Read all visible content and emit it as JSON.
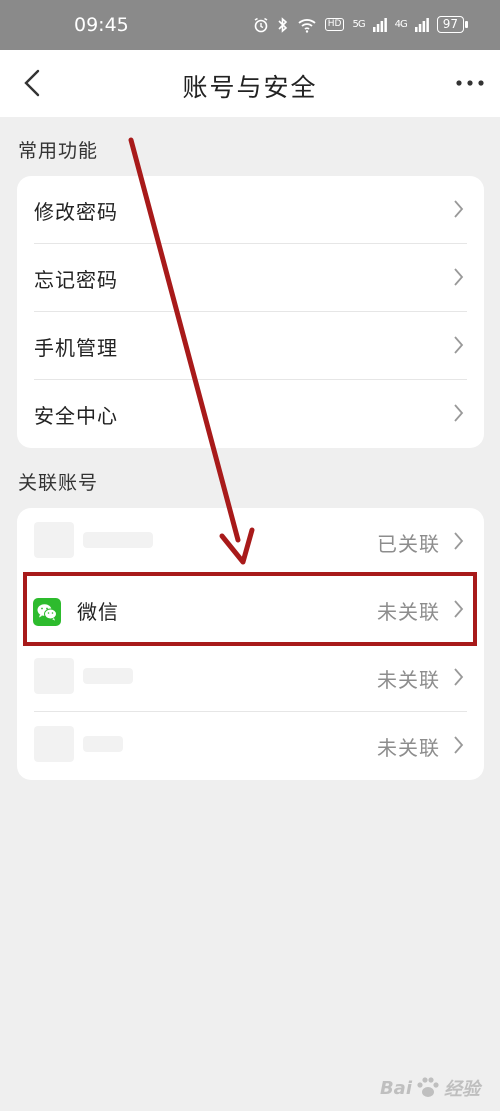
{
  "status_bar": {
    "time": "09:45",
    "network_5g": "5G",
    "network_4g": "4G",
    "hd": "HD",
    "battery": "97"
  },
  "header": {
    "title": "账号与安全"
  },
  "common_section": {
    "title": "常用功能",
    "items": [
      {
        "label": "修改密码"
      },
      {
        "label": "忘记密码"
      },
      {
        "label": "手机管理"
      },
      {
        "label": "安全中心"
      }
    ]
  },
  "linked_section": {
    "title": "关联账号",
    "items": [
      {
        "label": "",
        "status": "已关联"
      },
      {
        "label": "微信",
        "status": "未关联",
        "icon": "wechat-icon"
      },
      {
        "label": "",
        "status": "未关联"
      },
      {
        "label": "",
        "status": "未关联"
      }
    ]
  },
  "watermark": {
    "text": "Bai",
    "text2": "经验"
  },
  "colors": {
    "accent_red": "#a81a1a",
    "wechat_green": "#2dbb2d",
    "status_bar_bg": "#8a8a8a"
  }
}
